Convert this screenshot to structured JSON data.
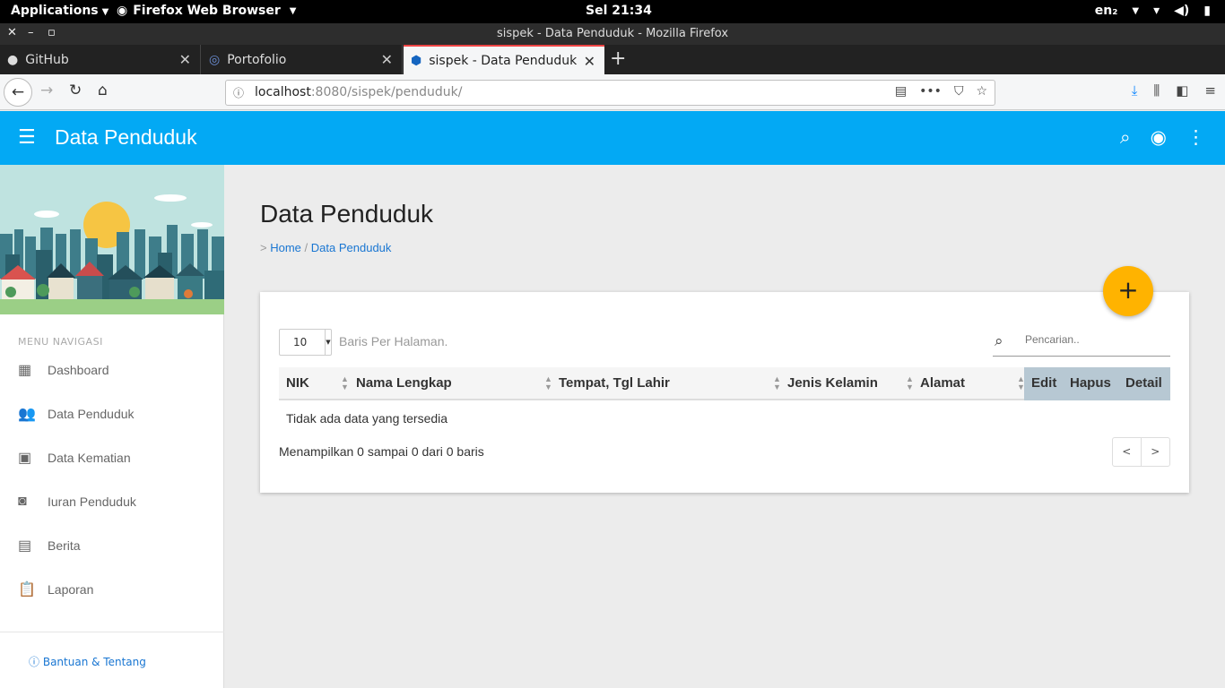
{
  "os": {
    "applications_label": "Applications",
    "browser_label": "Firefox Web Browser",
    "clock": "Sel 21:34",
    "keyboard": "en₂"
  },
  "window": {
    "title": "sispek - Data Penduduk - Mozilla Firefox",
    "close": "✕",
    "minimize": "–",
    "maximize": "▫"
  },
  "tabs": [
    {
      "label": "GitHub",
      "close": "✕"
    },
    {
      "label": "Portofolio",
      "close": "✕"
    },
    {
      "label": "sispek - Data Penduduk",
      "close": "✕"
    }
  ],
  "new_tab": "+",
  "url": {
    "host": "localhost",
    "rest": ":8080/sispek/penduduk/"
  },
  "app": {
    "title": "Data Penduduk"
  },
  "sidebar": {
    "header": "MENU NAVIGASI",
    "items": [
      {
        "label": "Dashboard",
        "icon": "dashboard-icon"
      },
      {
        "label": "Data Penduduk",
        "icon": "people-icon"
      },
      {
        "label": "Data Kematian",
        "icon": "badge-icon"
      },
      {
        "label": "Iuran Penduduk",
        "icon": "bag-icon"
      },
      {
        "label": "Berita",
        "icon": "news-icon"
      },
      {
        "label": "Laporan",
        "icon": "clipboard-icon"
      }
    ],
    "footer": "Bantuan & Tentang"
  },
  "page": {
    "title": "Data Penduduk",
    "breadcrumb_prefix": ">",
    "breadcrumb_home": "Home",
    "breadcrumb_sep": "/",
    "breadcrumb_current": "Data Penduduk"
  },
  "table": {
    "per_page": "10",
    "per_page_label": "Baris Per Halaman.",
    "search_placeholder": "Pencarian..",
    "columns": [
      "NIK",
      "Nama Lengkap",
      "Tempat, Tgl Lahir",
      "Jenis Kelamin",
      "Alamat"
    ],
    "actions": [
      "Edit",
      "Hapus",
      "Detail"
    ],
    "empty_text": "Tidak ada data yang tersedia",
    "info": "Menampilkan 0 sampai 0 dari 0 baris",
    "prev": "<",
    "next": ">"
  },
  "colors": {
    "appbar": "#03a9f4",
    "fab": "#ffb300",
    "link": "#1976d2",
    "action_header": "#b7c8d3"
  }
}
